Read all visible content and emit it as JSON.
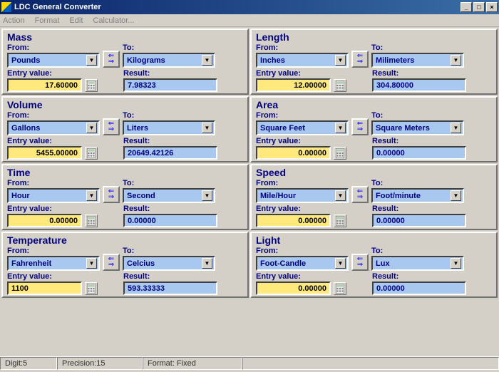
{
  "title": "LDC General Converter",
  "menu": {
    "action": "Action",
    "format": "Format",
    "edit": "Edit",
    "calculator": "Calculator..."
  },
  "panels": [
    {
      "title": "Mass",
      "from_label": "From:",
      "to_label": "To:",
      "from_unit": "Pounds",
      "to_unit": "Kilograms",
      "entry_label": "Entry value:",
      "result_label": "Result:",
      "entry": "17.60000",
      "result": "7.98323",
      "entry_align": "right"
    },
    {
      "title": "Length",
      "from_label": "From:",
      "to_label": "To:",
      "from_unit": "Inches",
      "to_unit": "Milimeters",
      "entry_label": "Entry value:",
      "result_label": "Result:",
      "entry": "12.00000",
      "result": "304.80000",
      "entry_align": "right"
    },
    {
      "title": "Volume",
      "from_label": "From:",
      "to_label": "To:",
      "from_unit": "Gallons",
      "to_unit": "Liters",
      "entry_label": "Entry value:",
      "result_label": "Result:",
      "entry": "5455.00000",
      "result": "20649.42126",
      "entry_align": "right"
    },
    {
      "title": "Area",
      "from_label": "From:",
      "to_label": "To:",
      "from_unit": "Square Feet",
      "to_unit": "Square Meters",
      "entry_label": "Entry value:",
      "result_label": "Result:",
      "entry": "0.00000",
      "result": "0.00000",
      "entry_align": "right"
    },
    {
      "title": "Time",
      "from_label": "From:",
      "to_label": "To:",
      "from_unit": "Hour",
      "to_unit": "Second",
      "entry_label": "Entry value:",
      "result_label": "Result:",
      "entry": "0.00000",
      "result": "0.00000",
      "entry_align": "right"
    },
    {
      "title": "Speed",
      "from_label": "From:",
      "to_label": "To:",
      "from_unit": "Mile/Hour",
      "to_unit": "Foot/minute",
      "entry_label": "Entry value:",
      "result_label": "Result:",
      "entry": "0.00000",
      "result": "0.00000",
      "entry_align": "right"
    },
    {
      "title": "Temperature",
      "from_label": "From:",
      "to_label": "To:",
      "from_unit": "Fahrenheit",
      "to_unit": "Celcius",
      "entry_label": "Entry value:",
      "result_label": "Result:",
      "entry": "1100",
      "result": "593.33333",
      "entry_align": "left"
    },
    {
      "title": "Light",
      "from_label": "From:",
      "to_label": "To:",
      "from_unit": "Foot-Candle",
      "to_unit": "Lux",
      "entry_label": "Entry value:",
      "result_label": "Result:",
      "entry": "0.00000",
      "result": "0.00000",
      "entry_align": "right"
    }
  ],
  "status": {
    "digit": "Digit:5",
    "precision": "Precision:15",
    "format": "Format: Fixed"
  }
}
